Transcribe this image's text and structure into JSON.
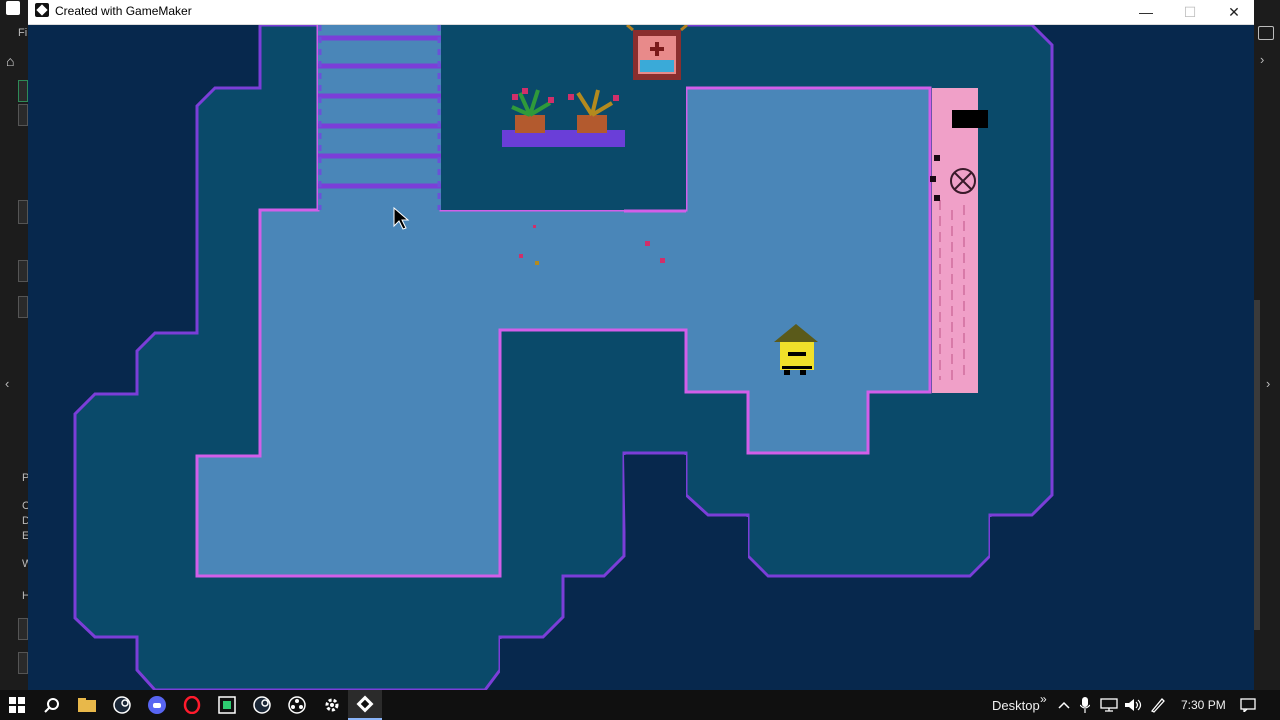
{
  "window": {
    "title": "Created with GameMaker",
    "controls": {
      "minimize": "—",
      "maximize": "☐",
      "close": "✕"
    }
  },
  "background_app": {
    "left_letters": [
      "Fi",
      "P",
      "C",
      "D",
      "E",
      "W",
      "H"
    ],
    "left_arrow": "‹",
    "right_arrow": "›"
  },
  "game": {
    "cursor": "arrow-cursor",
    "characters": [
      "player-sprite"
    ],
    "props": [
      "plant-pot-red",
      "plant-pot-gold",
      "wall-painting",
      "pink-door"
    ]
  },
  "taskbar": {
    "icons": [
      "windows-start-icon",
      "search-icon",
      "file-explorer-icon",
      "steam-icon",
      "discord-icon",
      "opera-icon",
      "gamemaker-icon",
      "steam-icon-2",
      "obs-icon",
      "settings-icon",
      "gamemaker-active-icon"
    ],
    "desktop_label": "Desktop",
    "overflow_label": "»",
    "time": "7:30 PM"
  },
  "colors": {
    "floor": "#4a86b8",
    "floor_edge": "#d35ee9",
    "water": "#0a4a6a",
    "deep": "#07284d",
    "water_edge": "#7b3ed8",
    "door": "#f0a0c8"
  }
}
